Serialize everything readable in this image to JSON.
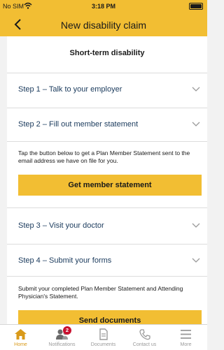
{
  "status_bar": {
    "carrier": "No SIM",
    "time": "3:18 PM"
  },
  "header": {
    "title": "New disability claim"
  },
  "main": {
    "section_title": "Short-term disability",
    "steps": [
      {
        "label": "Step 1 – Talk to your employer"
      },
      {
        "label": "Step 2 – Fill out member statement",
        "description": "Tap the button below to get a Plan Member Statement sent to the email address we have on file for you.",
        "button_label": "Get member statement"
      },
      {
        "label": "Step 3 – Visit your doctor"
      },
      {
        "label": "Step 4 – Submit your forms",
        "description": "Submit your completed Plan Member Statement and Attending Physician's Statement.",
        "button_label": "Send documents"
      }
    ]
  },
  "tabbar": {
    "tabs": [
      {
        "label": "Home",
        "icon": "home-icon",
        "active": true
      },
      {
        "label": "Notifications",
        "icon": "notifications-icon",
        "badge": "2"
      },
      {
        "label": "Documents",
        "icon": "documents-icon"
      },
      {
        "label": "Contact us",
        "icon": "phone-icon"
      },
      {
        "label": "More",
        "icon": "menu-icon"
      }
    ]
  },
  "colors": {
    "accent": "#f2be33",
    "step_text": "#1a3a5c",
    "badge": "#c8102e",
    "active_tab": "#d99a1a"
  }
}
